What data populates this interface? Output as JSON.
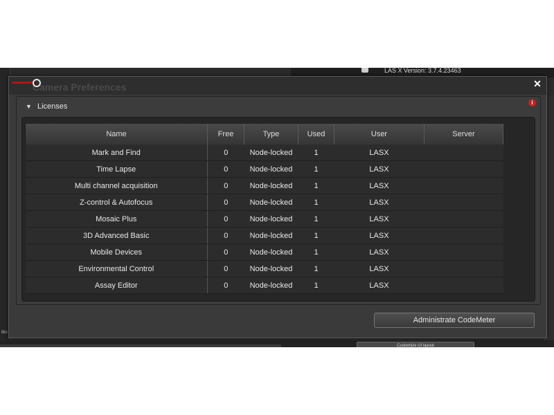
{
  "background": {
    "version_label": "LAS X Version: 3.7.4.23463",
    "bottom_button_label": "Customize UI layout",
    "left_bottom_label": "Bin"
  },
  "dialog": {
    "title": "Camera Preferences",
    "close_label": "✕",
    "section": {
      "arrow": "▼",
      "title": "Licenses",
      "info_icon": "i"
    },
    "table": {
      "columns": [
        "Name",
        "Free",
        "Type",
        "Used",
        "User",
        "Server"
      ],
      "rows": [
        {
          "name": "Mark and Find",
          "free": "0",
          "type": "Node-locked",
          "used": "1",
          "user": "LASX",
          "server": ""
        },
        {
          "name": "Time Lapse",
          "free": "0",
          "type": "Node-locked",
          "used": "1",
          "user": "LASX",
          "server": ""
        },
        {
          "name": "Multi channel acquisition",
          "free": "0",
          "type": "Node-locked",
          "used": "1",
          "user": "LASX",
          "server": ""
        },
        {
          "name": "Z-control & Autofocus",
          "free": "0",
          "type": "Node-locked",
          "used": "1",
          "user": "LASX",
          "server": ""
        },
        {
          "name": "Mosaic Plus",
          "free": "0",
          "type": "Node-locked",
          "used": "1",
          "user": "LASX",
          "server": ""
        },
        {
          "name": "3D Advanced Basic",
          "free": "0",
          "type": "Node-locked",
          "used": "1",
          "user": "LASX",
          "server": ""
        },
        {
          "name": "Mobile Devices",
          "free": "0",
          "type": "Node-locked",
          "used": "1",
          "user": "LASX",
          "server": ""
        },
        {
          "name": "Environmental Control",
          "free": "0",
          "type": "Node-locked",
          "used": "1",
          "user": "LASX",
          "server": ""
        },
        {
          "name": "Assay Editor",
          "free": "0",
          "type": "Node-locked",
          "used": "1",
          "user": "LASX",
          "server": ""
        }
      ]
    },
    "admin_button_label": "Administrate CodeMeter"
  },
  "colors": {
    "accent_red": "#b01515",
    "info_red": "#c62020",
    "dialog_bg": "#3a3a3a",
    "table_bg": "#2c2c2c"
  }
}
